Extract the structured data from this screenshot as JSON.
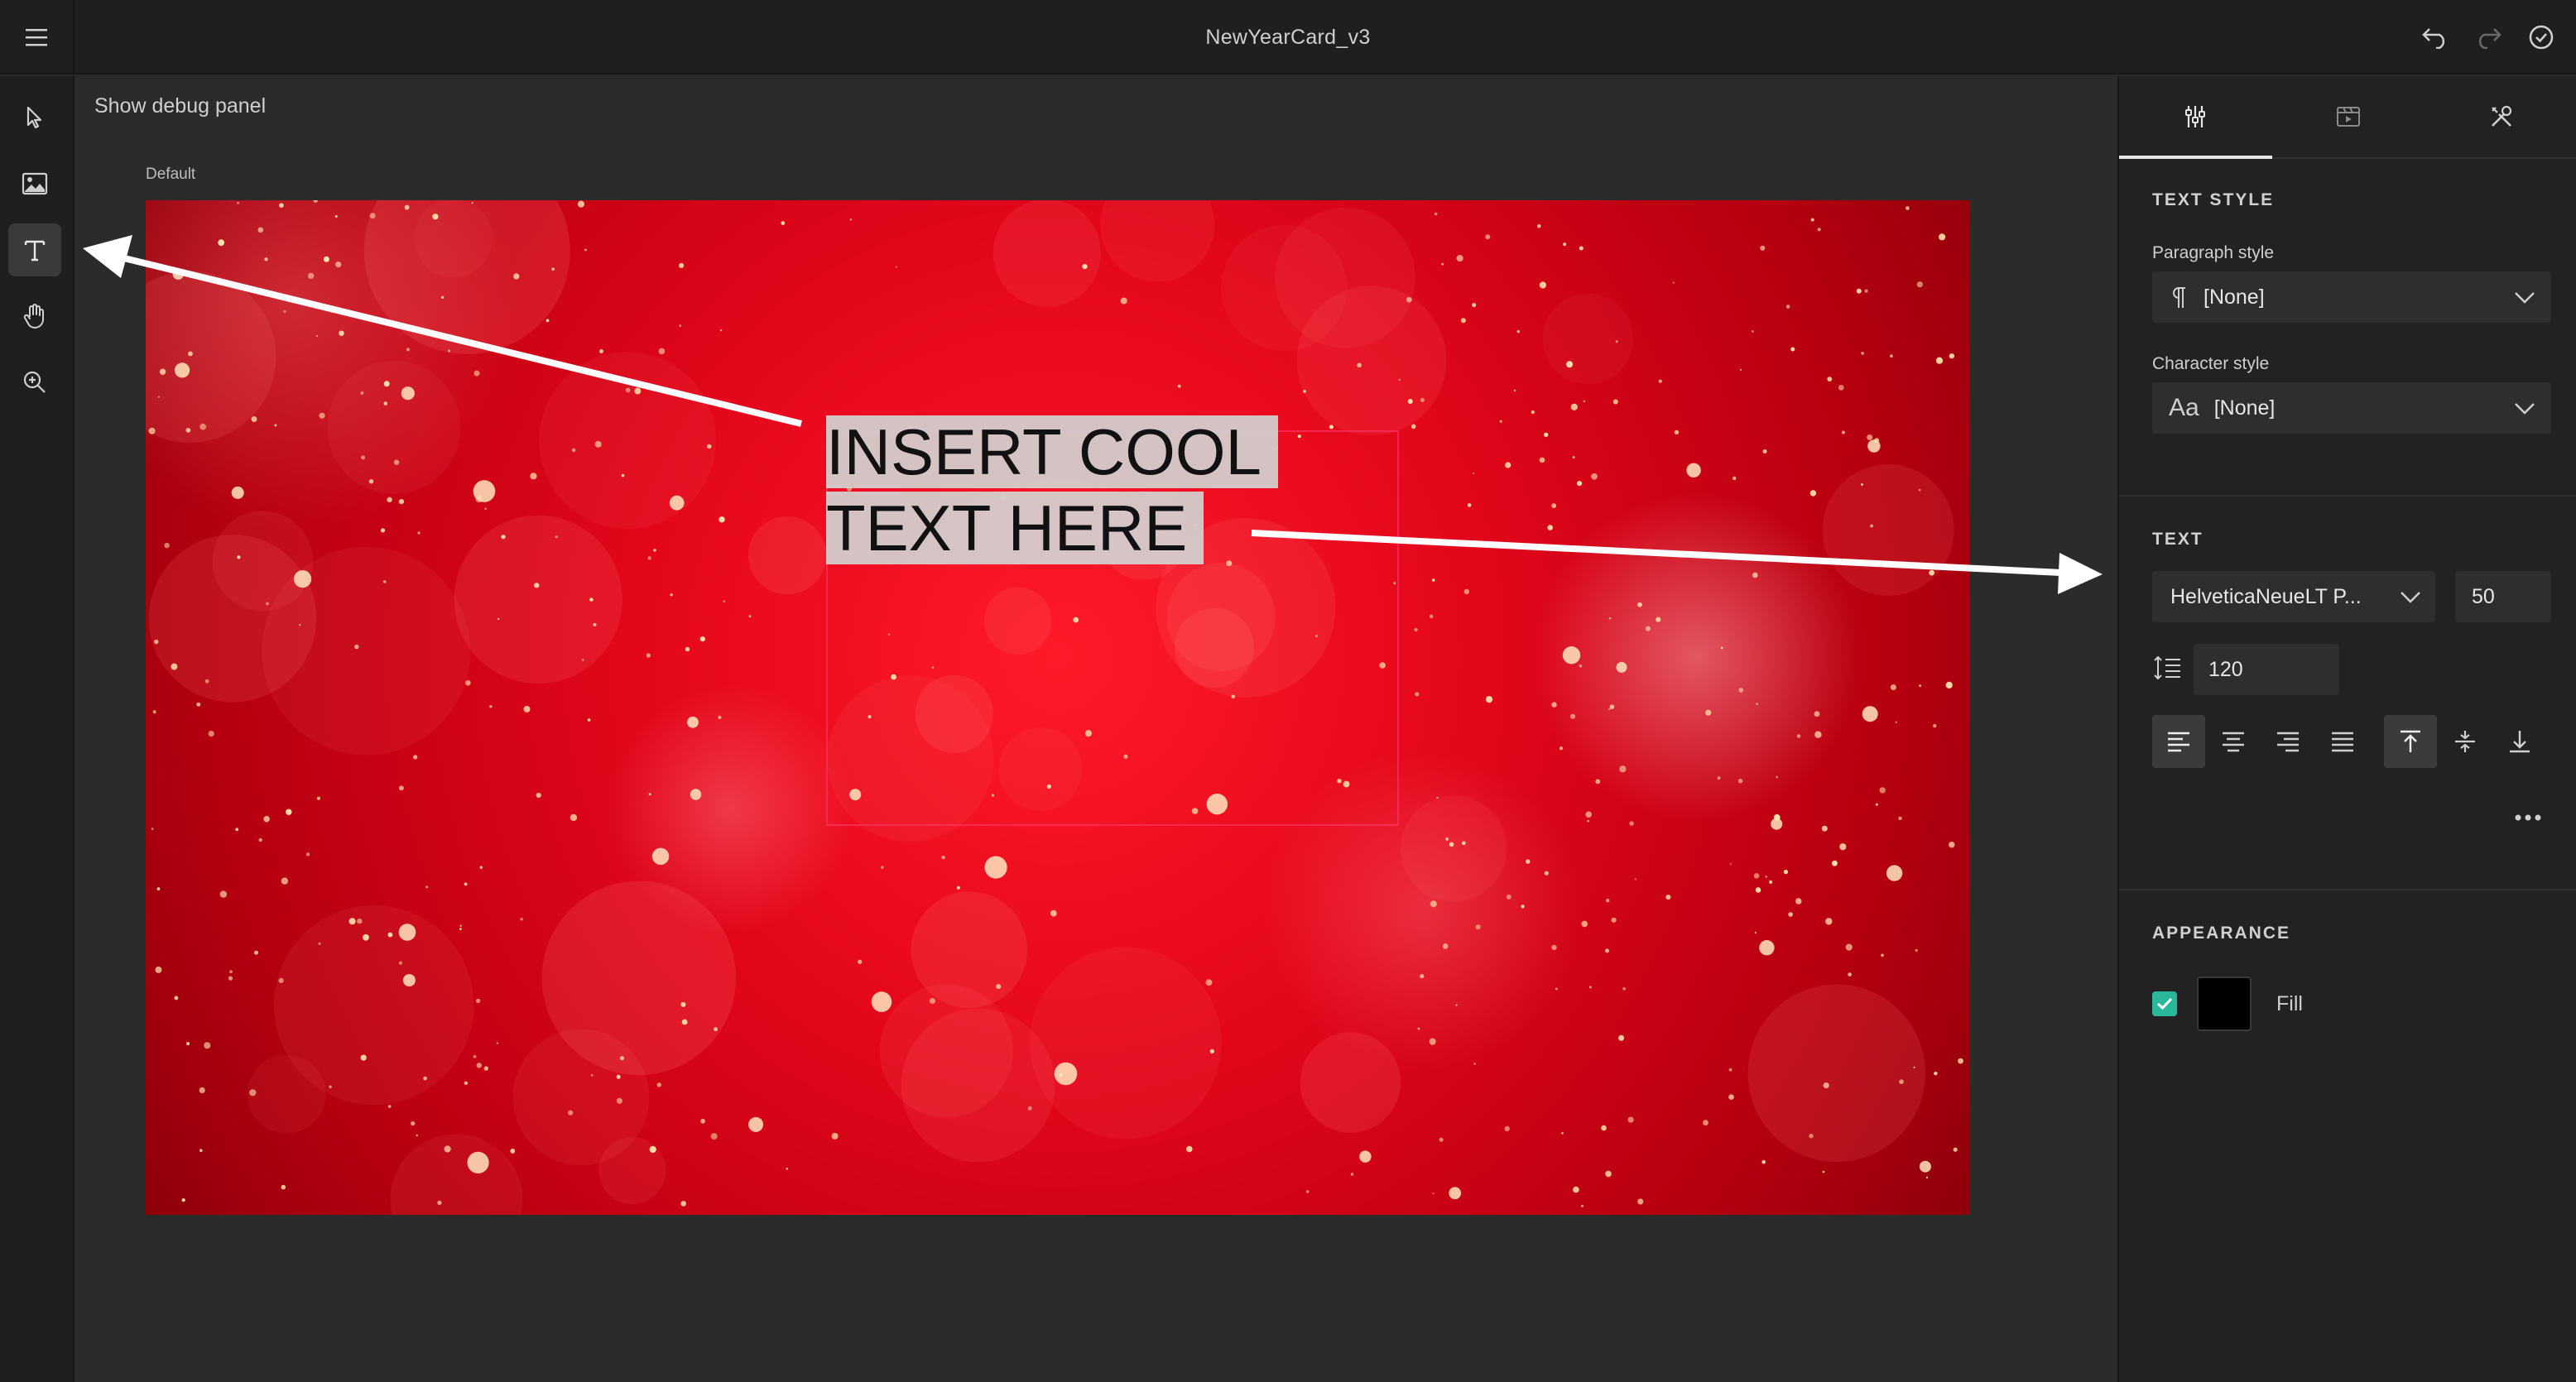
{
  "app": {
    "document_title": "NewYearCard_v3"
  },
  "icons": {
    "menu": "hamburger-menu-icon",
    "undo": "undo-icon",
    "redo": "redo-icon",
    "done": "check-circle-icon",
    "tools": [
      "select-pointer-icon",
      "image-icon",
      "text-tool-icon",
      "hand-pan-icon",
      "zoom-in-icon"
    ]
  },
  "canvas": {
    "debug_link": "Show debug panel",
    "artboard_label": "Default",
    "text_lines": [
      "INSERT COOL",
      "TEXT HERE"
    ]
  },
  "panel": {
    "tabs": [
      "sliders-icon",
      "media-icon",
      "tools-icon"
    ],
    "text_style": {
      "title": "TEXT STYLE",
      "paragraph_label": "Paragraph style",
      "paragraph_value": "[None]",
      "character_label": "Character style",
      "character_value": "[None]",
      "character_glyph": "Aa"
    },
    "text": {
      "title": "TEXT",
      "font_family": "HelveticaNeueLT P...",
      "font_size": "50",
      "leading": "120",
      "align_buttons": [
        "align-left-icon",
        "align-center-icon",
        "align-right-icon",
        "align-justify-icon"
      ],
      "vertical_buttons": [
        "align-top-icon",
        "align-middle-icon",
        "align-bottom-icon"
      ]
    },
    "appearance": {
      "title": "APPEARANCE",
      "fill_label": "Fill",
      "fill_color": "#000000",
      "fill_checked": true,
      "check_color": "#2bb89a"
    }
  }
}
